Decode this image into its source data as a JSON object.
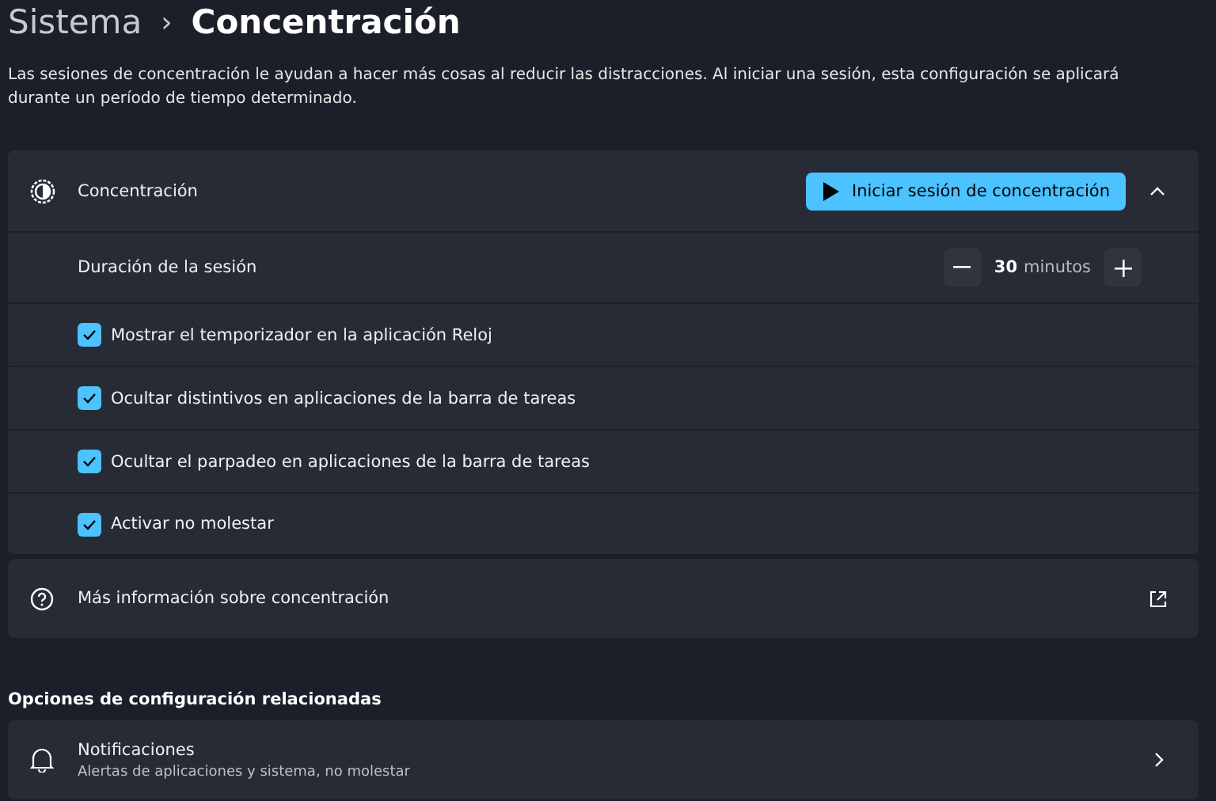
{
  "breadcrumb": {
    "parent": "Sistema",
    "separator": "›",
    "current": "Concentración"
  },
  "description": "Las sesiones de concentración le ayudan a hacer más cosas al reducir las distracciones. Al iniciar una sesión, esta configuración se aplicará durante un período de tiempo determinado.",
  "focus_card": {
    "title": "Concentración",
    "start_button": "Iniciar sesión de concentración",
    "expanded": true,
    "duration": {
      "label": "Duración de la sesión",
      "value": "30",
      "unit": "minutos"
    },
    "options": [
      {
        "label": "Mostrar el temporizador en la aplicación Reloj",
        "checked": true
      },
      {
        "label": "Ocultar distintivos en aplicaciones de la barra de tareas",
        "checked": true
      },
      {
        "label": "Ocultar el parpadeo en aplicaciones de la barra de tareas",
        "checked": true
      },
      {
        "label": "Activar no molestar",
        "checked": true
      }
    ]
  },
  "info_link": {
    "label": "Más información sobre concentración"
  },
  "related": {
    "heading": "Opciones de configuración relacionadas",
    "items": [
      {
        "title": "Notificaciones",
        "subtitle": "Alertas de aplicaciones y sistema, no molestar"
      }
    ]
  }
}
